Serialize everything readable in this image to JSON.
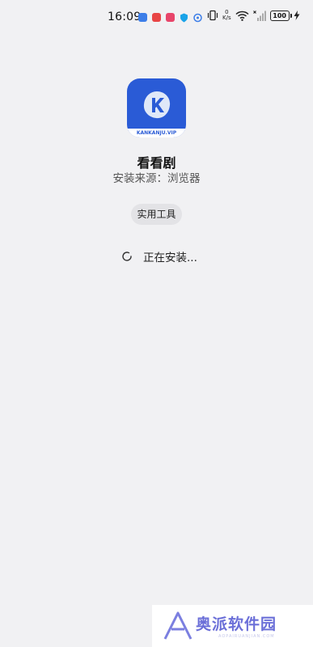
{
  "status_bar": {
    "time": "16:09",
    "netspeed_value": "0",
    "netspeed_unit": "K/s",
    "battery": "100"
  },
  "app": {
    "icon_caption": "KANKANJU.VIP",
    "name": "看看剧",
    "install_source": "安装来源：浏览器"
  },
  "tag": "实用工具",
  "status_text": "正在安装...",
  "watermark": {
    "text": "奥派软件园",
    "sub": "AOPAIRUANJIAN.COM"
  },
  "colors": {
    "accent": "#2a5bd6",
    "background": "#f1f1f3",
    "watermark": "#6b6fd8"
  }
}
